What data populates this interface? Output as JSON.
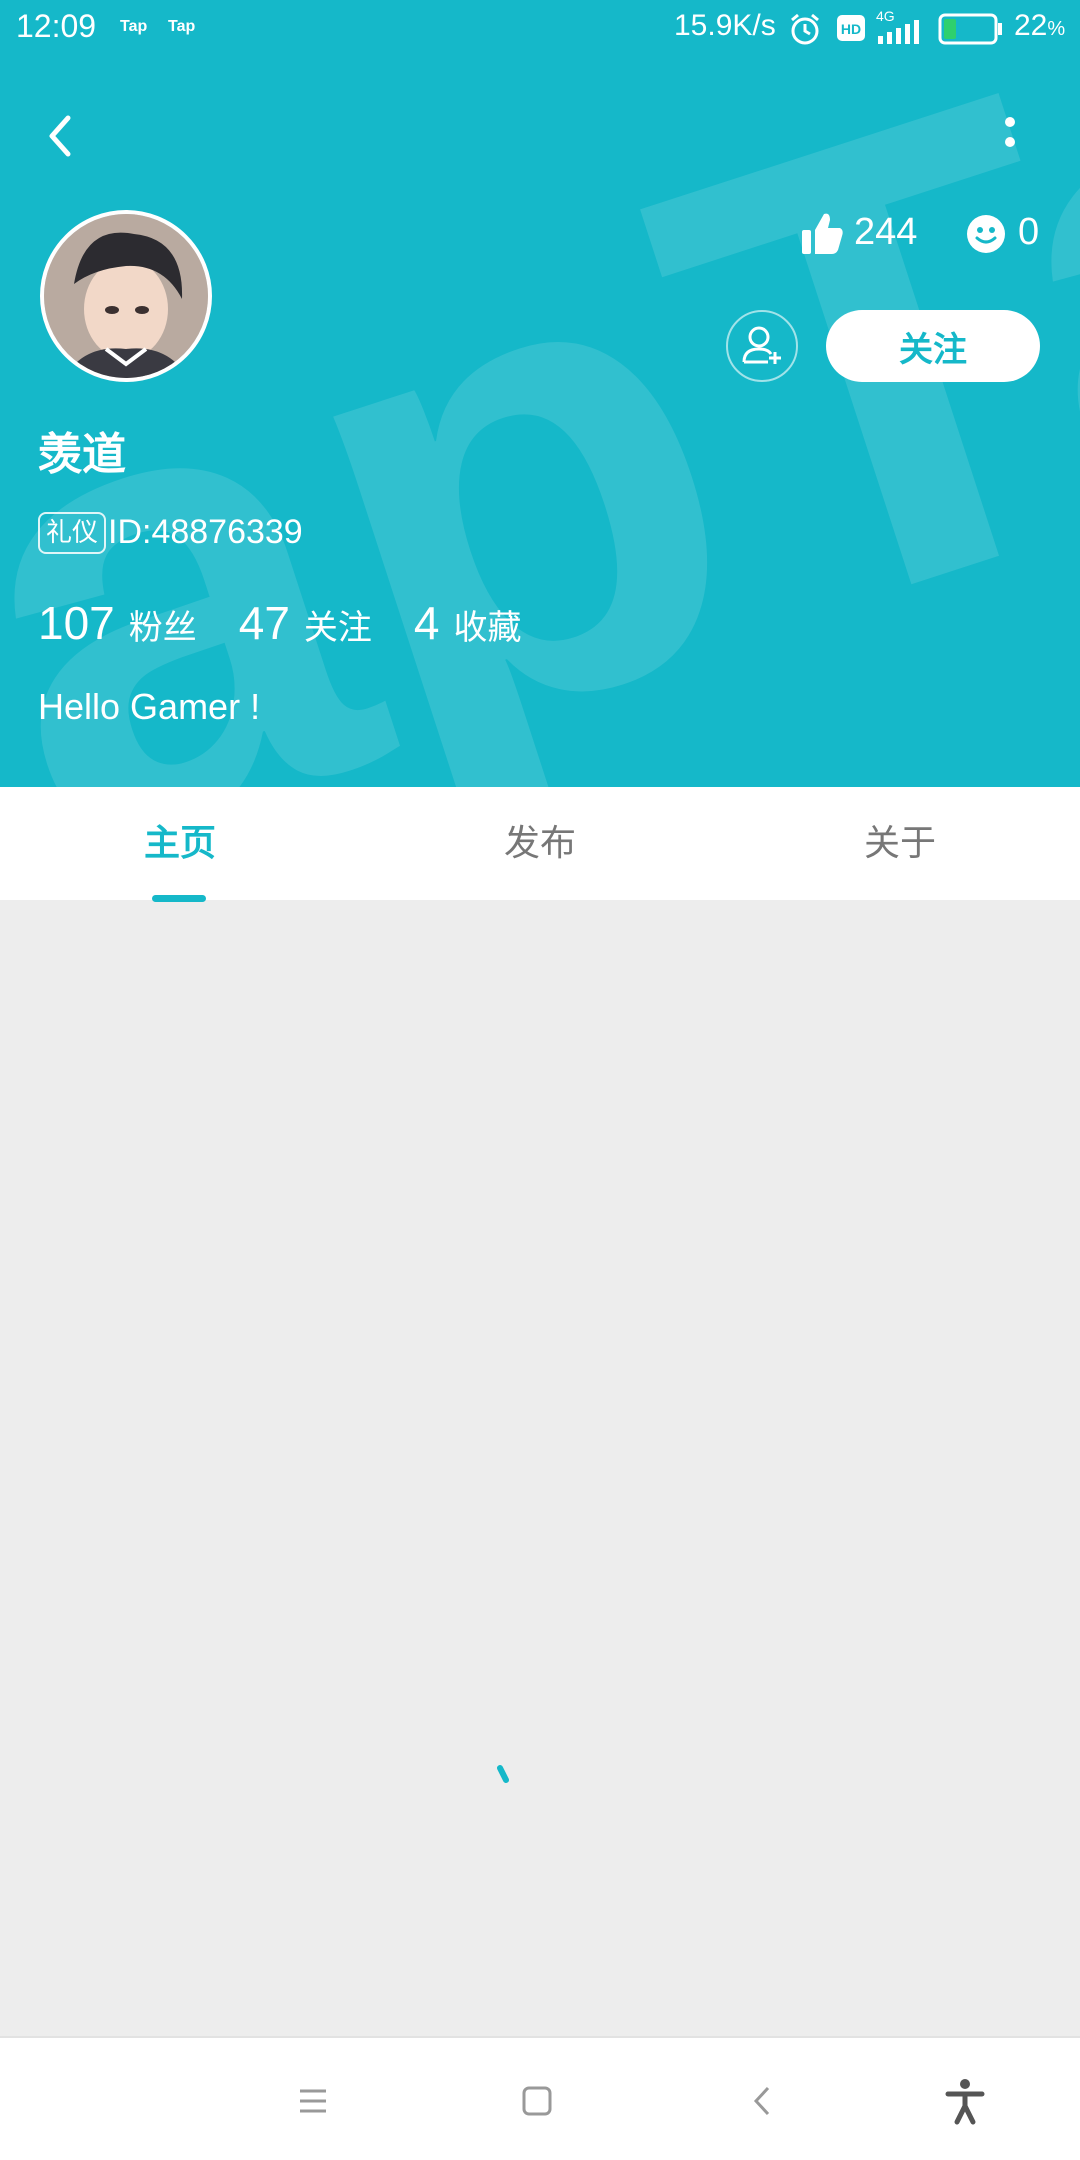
{
  "status_bar": {
    "time": "12:09",
    "app_icons": [
      "Tap",
      "Tap"
    ],
    "net_speed": "15.9K/s",
    "icons": [
      "alarm-icon",
      "hd-icon",
      "signal-4g-icon",
      "battery-icon"
    ],
    "network_type": "4G",
    "battery_percent": "22",
    "battery_symbol": "%",
    "battery_level": 0.22
  },
  "header": {
    "back_icon": "back-arrow-icon",
    "more_icon": "more-vertical-icon",
    "watermark_text": "TapTap",
    "bg_color": "#15b8c9",
    "accent_color": "#15b8c9"
  },
  "profile": {
    "username": "羡道",
    "badge": "礼仪",
    "user_id": "ID:48876339",
    "likes": "244",
    "smiles": "0",
    "follow_label": "关注",
    "add_friend_icon": "add-user-icon",
    "bio": "Hello Gamer !",
    "stats": [
      {
        "num": "107",
        "label": "粉丝"
      },
      {
        "num": "47",
        "label": "关注"
      },
      {
        "num": "4",
        "label": "收藏"
      }
    ]
  },
  "tabs": [
    {
      "label": "主页",
      "active": true
    },
    {
      "label": "发布",
      "active": false
    },
    {
      "label": "关于",
      "active": false
    }
  ],
  "nav_bar": {
    "icons": [
      "menu-icon",
      "home-square-icon",
      "back-chevron-icon",
      "accessibility-icon"
    ]
  }
}
